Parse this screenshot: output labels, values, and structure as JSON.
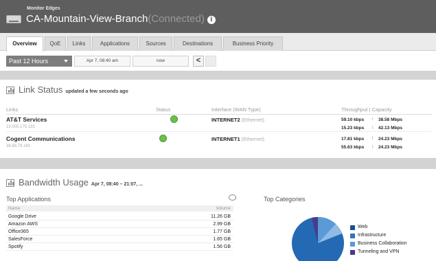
{
  "header": {
    "org": "Monitor Edges",
    "device_name": "CA-Mountain-View-Branch",
    "status": "(Connected)"
  },
  "tabs": [
    {
      "label": "Overview",
      "active": true
    },
    {
      "label": "QoE"
    },
    {
      "label": "Links"
    },
    {
      "label": "Applications"
    },
    {
      "label": "Sources"
    },
    {
      "label": "Destinations"
    },
    {
      "label": "Business Priority"
    }
  ],
  "filter": {
    "range": "Past 12 Hours",
    "from": "Apr 7, 08:40 am",
    "to": "now",
    "prev": "<"
  },
  "link_status": {
    "title": "Link Status",
    "updated": "updated a few seconds ago",
    "columns": [
      "Links",
      "Status",
      "Interface (WAN Type)",
      "Throughput | Capacity"
    ],
    "rows": [
      {
        "name": "AT&T Services",
        "ip": "13.005.175.133",
        "status": "up",
        "interface": "INTERNET2",
        "wan_type": "(Ethernet)",
        "up_throughput": "59.10 kbps",
        "up_capacity": "38.58 Mbps",
        "down_throughput": "15.23 kbps",
        "down_capacity": "42.13 Mbps"
      },
      {
        "name": "Cogent Communications",
        "ip": "38.88.79.180",
        "status": "up",
        "interface": "INTERNET1",
        "wan_type": "(Ethernet)",
        "up_throughput": "17.81 kbps",
        "up_capacity": "24.23 Mbps",
        "down_throughput": "55.63 kbps",
        "down_capacity": "24.23 Mbps"
      }
    ]
  },
  "bandwidth": {
    "title": "Bandwidth Usage",
    "range": "Apr 7, 08:40 – 21:07, ..."
  },
  "top_applications": {
    "title": "Top Applications",
    "columns": [
      "Name",
      "Volume"
    ],
    "rows": [
      {
        "name": "Google Drive",
        "volume": "11.26 GB"
      },
      {
        "name": "Amazon AWS",
        "volume": "2.99 GB"
      },
      {
        "name": "Office365",
        "volume": "1.77 GB"
      },
      {
        "name": "SalesForce",
        "volume": "1.65 GB"
      },
      {
        "name": "Spotify",
        "volume": "1.56 GB"
      }
    ]
  },
  "top_categories": {
    "title": "Top Categories",
    "legend": [
      {
        "label": "Web",
        "color": "#1c4f8a"
      },
      {
        "label": "Infrastructure",
        "color": "#2f74bd"
      },
      {
        "label": "Business Collaboration",
        "color": "#5a9ad6"
      },
      {
        "label": "Tunneling and VPN",
        "color": "#4a3a8c"
      }
    ]
  },
  "colors": {
    "header_bg": "#5e5e5e",
    "status_up": "#6cc04a"
  }
}
